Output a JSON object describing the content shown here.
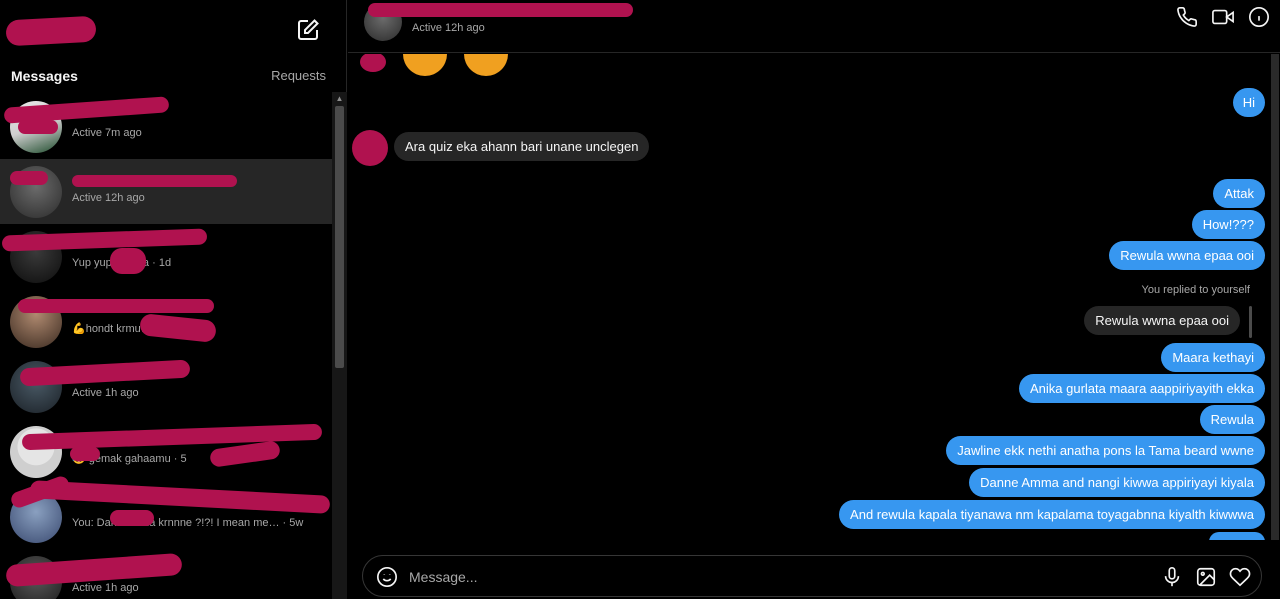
{
  "sidebar": {
    "tabs": {
      "messages": "Messages",
      "requests": "Requests"
    },
    "conversations": [
      {
        "name": "",
        "sub": "Active 7m ago",
        "active": false
      },
      {
        "name": "",
        "sub": "Active 12h ago",
        "active": true
      },
      {
        "name": "",
        "sub": "Yup yup… ekka · 1d",
        "active": false
      },
      {
        "name": "",
        "sub": "💪hondt krmu…",
        "active": false
      },
      {
        "name": "",
        "sub": "Active 1h ago",
        "active": false
      },
      {
        "name": "",
        "sub": "😂 gemak gahaamu · 5",
        "active": false
      },
      {
        "name": "",
        "sub": "You: Dan m… da krnnne ?!?! I mean me… · 5w",
        "active": false
      },
      {
        "name": "",
        "sub": "Active 1h ago",
        "active": false
      }
    ]
  },
  "chat": {
    "header": {
      "name": "",
      "status": "Active 12h ago"
    },
    "messages": {
      "m1": "Hi",
      "m2": "Ara quiz eka ahann bari unane unclegen",
      "m3": "Attak",
      "m4": "How!???",
      "m5": "Rewula wwna epaa ooi",
      "reply_label": "You replied to yourself",
      "reply_quote": "Rewula wwna epaa ooi",
      "m6": "Maara kethayi",
      "m7": "Anika gurlata maara aappiriyayith ekka",
      "m8": "Rewula",
      "m9": "Jawline ekk nethi anatha pons la Tama beard wwne",
      "m10": "Danne Amma and nangi kiwwa appiriyayi kiyala",
      "m11": "And rewula kapala tiyanawa nm kapalama toyagabnna kiyalth kiwwwa"
    },
    "composer": {
      "placeholder": "Message..."
    }
  },
  "colors": {
    "outgoing": "#3797f0",
    "incoming": "#262626",
    "redaction": "#b0124f"
  },
  "icons": [
    "compose-icon",
    "phone-icon",
    "video-icon",
    "info-icon",
    "emoji-icon",
    "mic-icon",
    "image-icon",
    "heart-icon"
  ]
}
